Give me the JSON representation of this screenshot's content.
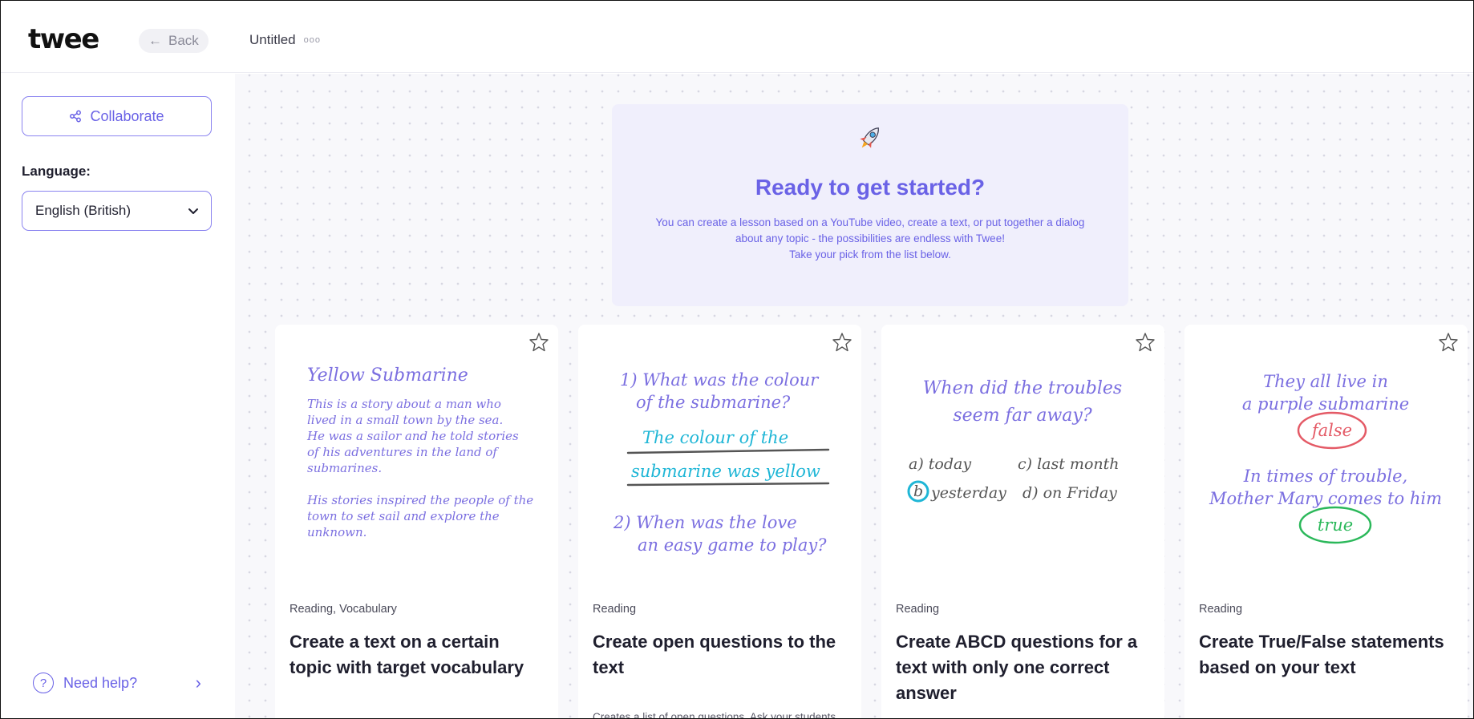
{
  "header": {
    "logo": "twee",
    "back_label": "Back",
    "doc_title": "Untitled",
    "doc_menu_glyph": "ooo"
  },
  "sidebar": {
    "collaborate_label": "Collaborate",
    "language_label": "Language:",
    "language_value": "English (British)",
    "help_label": "Need help?"
  },
  "hero": {
    "icon": "rocket-icon",
    "title": "Ready to get started?",
    "line1": "You can create a lesson based on a YouTube video, create a text, or put together a dialog about any topic - the possibilities are endless with Twee!",
    "line2": "Take your pick from the list below."
  },
  "colors": {
    "accent": "#6a62e6",
    "accent_border": "#8b84f0",
    "canvas": "#f8f8fb",
    "hero_bg": "#f0effc",
    "handwriting": "#7b6fe0",
    "cyan": "#1fb6d6",
    "red": "#e45a66",
    "green": "#2bb85a"
  },
  "cards": [
    {
      "tag": "Reading, Vocabulary",
      "title": "Create a text on a certain topic with target vocabulary",
      "description": "",
      "art": {
        "heading": "Yellow Submarine",
        "lines": [
          "This is a story about a man who",
          "lived in a small town by the sea.",
          "He was a sailor and he told stories",
          "of his adventures in the land of",
          "submarines.",
          "",
          "His stories inspired the people of the",
          "town to set sail and explore the",
          "unknown."
        ]
      }
    },
    {
      "tag": "Reading",
      "title": "Create open questions to the text",
      "description": "Creates a list of open questions. Ask your students these questions to make sure",
      "art": {
        "q1a": "1) What was the colour",
        "q1b": "of the submarine?",
        "a1a": "The colour of the",
        "a1b": "submarine was yellow",
        "q2a": "2) When was the love",
        "q2b": "an easy game to play?"
      }
    },
    {
      "tag": "Reading",
      "title": "Create ABCD questions for a text with only one correct answer",
      "description": "",
      "art": {
        "qa": "When did the troubles",
        "qb": "seem far away?",
        "opt_a": "a) today",
        "opt_c": "c) last month",
        "opt_b_letter": "b",
        "opt_b": "yesterday",
        "opt_d": "d) on Friday"
      }
    },
    {
      "tag": "Reading",
      "title": "Create True/False statements based on your text",
      "description": "",
      "art": {
        "s1a": "They all live in",
        "s1b": "a purple submarine",
        "v1": "false",
        "s2a": "In times of trouble,",
        "s2b": "Mother Mary comes to him",
        "v2": "true"
      }
    }
  ]
}
